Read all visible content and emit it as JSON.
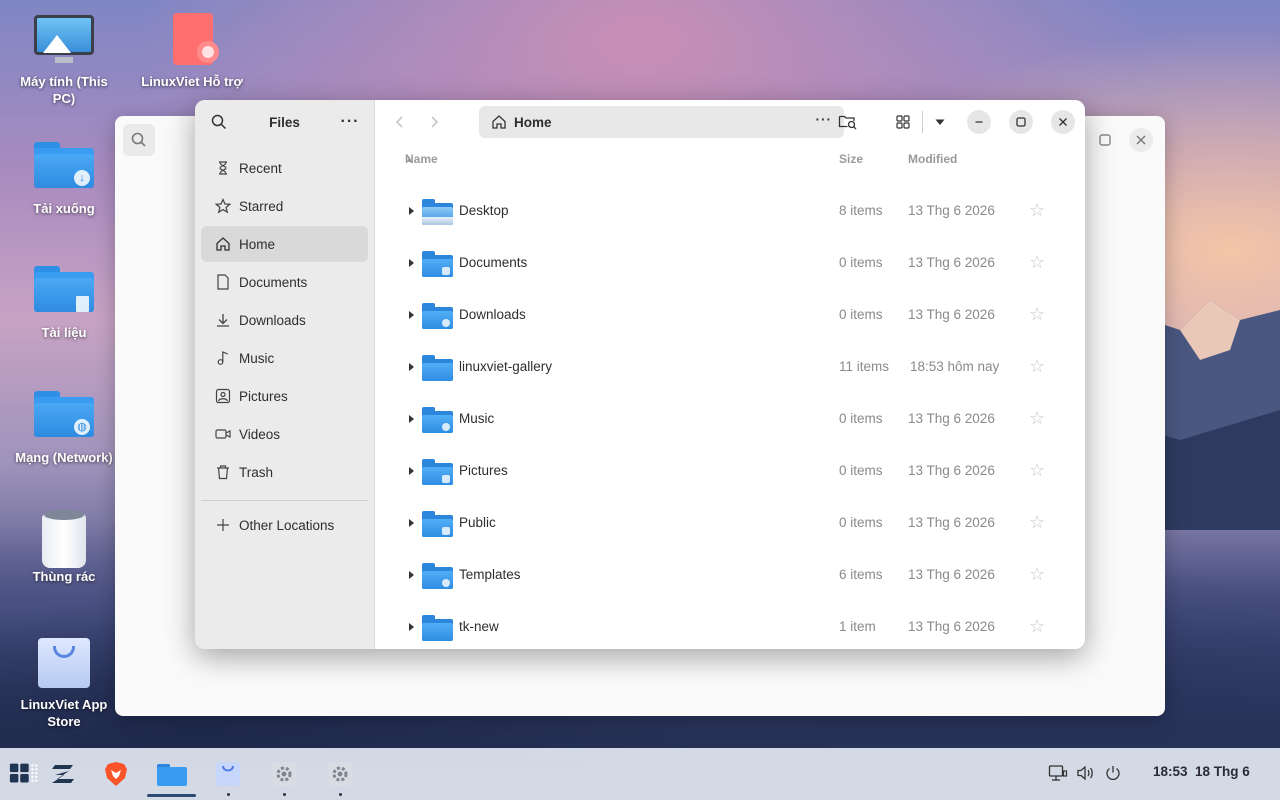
{
  "desktop": {
    "icons": [
      {
        "label": "Máy tính (This PC)",
        "icon": "computer-icon"
      },
      {
        "label": "LinuxViet Hỗ trợ",
        "icon": "help-icon"
      },
      {
        "label": "Tải xuống",
        "icon": "downloads-folder-icon"
      },
      {
        "label": "Tài liệu",
        "icon": "documents-folder-icon"
      },
      {
        "label": "Mạng (Network)",
        "icon": "network-folder-icon"
      },
      {
        "label": "Thùng rác",
        "icon": "trash-icon"
      },
      {
        "label": "LinuxViet App Store",
        "icon": "store-icon"
      }
    ]
  },
  "window": {
    "sidebar": {
      "title": "Files",
      "items": [
        {
          "label": "Recent",
          "icon": "clock-icon"
        },
        {
          "label": "Starred",
          "icon": "star-icon"
        },
        {
          "label": "Home",
          "icon": "home-icon",
          "active": true
        },
        {
          "label": "Documents",
          "icon": "document-icon"
        },
        {
          "label": "Downloads",
          "icon": "download-icon"
        },
        {
          "label": "Music",
          "icon": "music-icon"
        },
        {
          "label": "Pictures",
          "icon": "picture-icon"
        },
        {
          "label": "Videos",
          "icon": "video-icon"
        },
        {
          "label": "Trash",
          "icon": "trash-icon"
        }
      ],
      "other_locations": "Other Locations"
    },
    "path": "Home",
    "columns": {
      "name": "Name",
      "size": "Size",
      "modified": "Modified"
    },
    "files": [
      {
        "name": "Desktop",
        "size": "8 items",
        "modified": "13 Thg 6 2026"
      },
      {
        "name": "Documents",
        "size": "0 items",
        "modified": "13 Thg 6 2026"
      },
      {
        "name": "Downloads",
        "size": "0 items",
        "modified": "13 Thg 6 2026"
      },
      {
        "name": "linuxviet-gallery",
        "size": "11 items",
        "modified": "18:53 hôm nay"
      },
      {
        "name": "Music",
        "size": "0 items",
        "modified": "13 Thg 6 2026"
      },
      {
        "name": "Pictures",
        "size": "0 items",
        "modified": "13 Thg 6 2026"
      },
      {
        "name": "Public",
        "size": "0 items",
        "modified": "13 Thg 6 2026"
      },
      {
        "name": "Templates",
        "size": "6 items",
        "modified": "13 Thg 6 2026"
      },
      {
        "name": "tk-new",
        "size": "1 item",
        "modified": "13 Thg 6 2026"
      }
    ]
  },
  "taskbar": {
    "clock": "18:53  18 Thg 6",
    "apps": [
      "app-grid-icon",
      "zorin-menu-icon",
      "brave-browser-icon",
      "files-icon",
      "store-icon",
      "settings-icon",
      "settings-icon"
    ]
  },
  "colors": {
    "accent": "#3a9cf0",
    "taskbar": "#e1e6f0",
    "sidebar": "#ebebeb"
  }
}
